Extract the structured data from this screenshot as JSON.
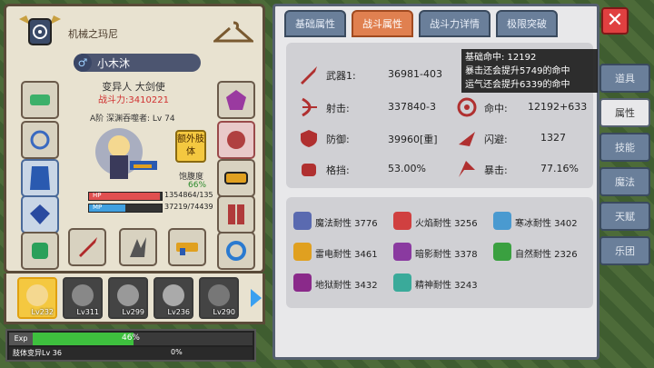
{
  "guild": {
    "name": "机械之玛尼"
  },
  "hero": {
    "name": "小木沐",
    "gender_symbol": "♂",
    "class": "变异人 大剑使",
    "power": "战斗力:3410221",
    "rank": "A阶 深渊吞噬者: Lv 74",
    "extra_btn": "额外肢体",
    "hunger_label": "饱腹度",
    "hunger_value": "66%",
    "hp_label": "HP",
    "hp_value": "1354864/135",
    "hp_ratio": 0.98,
    "mp_label": "MP",
    "mp_value": "37219/74439",
    "mp_ratio": 0.5
  },
  "roster": [
    {
      "level": "Lv232",
      "selected": true
    },
    {
      "level": "Lv311",
      "selected": false
    },
    {
      "level": "Lv299",
      "selected": false
    },
    {
      "level": "Lv236",
      "selected": false
    },
    {
      "level": "Lv290",
      "selected": false
    }
  ],
  "exp": {
    "label": "Exp",
    "percent": "46%",
    "ratio": 0.46,
    "sub_label": "肢体变异Lv 36",
    "sub_percent": "0%"
  },
  "tabs": [
    "基础属性",
    "战斗属性",
    "战斗力详情",
    "极限突破"
  ],
  "active_tab": 1,
  "combat_stats": [
    {
      "label": "武器1:",
      "value": "36981-403"
    },
    {
      "label": "命中:",
      "value": "12192+633"
    },
    {
      "label": "射击:",
      "value": "337840-3"
    },
    {
      "label": "闪避:",
      "value": "1327"
    },
    {
      "label": "防御:",
      "value": "39960[重]"
    },
    {
      "label": "暴击:",
      "value": "77.16%"
    },
    {
      "label": "格挡:",
      "value": "53.00%"
    }
  ],
  "tooltip": {
    "line1": "基础命中: 12192",
    "line2": "暴击还会提升5749的命中",
    "line3": "运气还会提升6339的命中"
  },
  "resistances": [
    {
      "label": "魔法耐性 3776",
      "color": "#5a6ab0"
    },
    {
      "label": "火焰耐性 3256",
      "color": "#d04040"
    },
    {
      "label": "寒冰耐性 3402",
      "color": "#4a9ad0"
    },
    {
      "label": "雷电耐性 3461",
      "color": "#e0a020"
    },
    {
      "label": "暗影耐性 3378",
      "color": "#8a3aa0"
    },
    {
      "label": "自然耐性 2326",
      "color": "#3aa040"
    },
    {
      "label": "地狱耐性 3432",
      "color": "#8a2a8a"
    },
    {
      "label": "精神耐性 3243",
      "color": "#3aaa9a"
    }
  ],
  "side_tabs": [
    "道具",
    "属性",
    "技能",
    "魔法",
    "天赋",
    "乐团"
  ],
  "active_side_tab": 1,
  "close_symbol": "✕"
}
